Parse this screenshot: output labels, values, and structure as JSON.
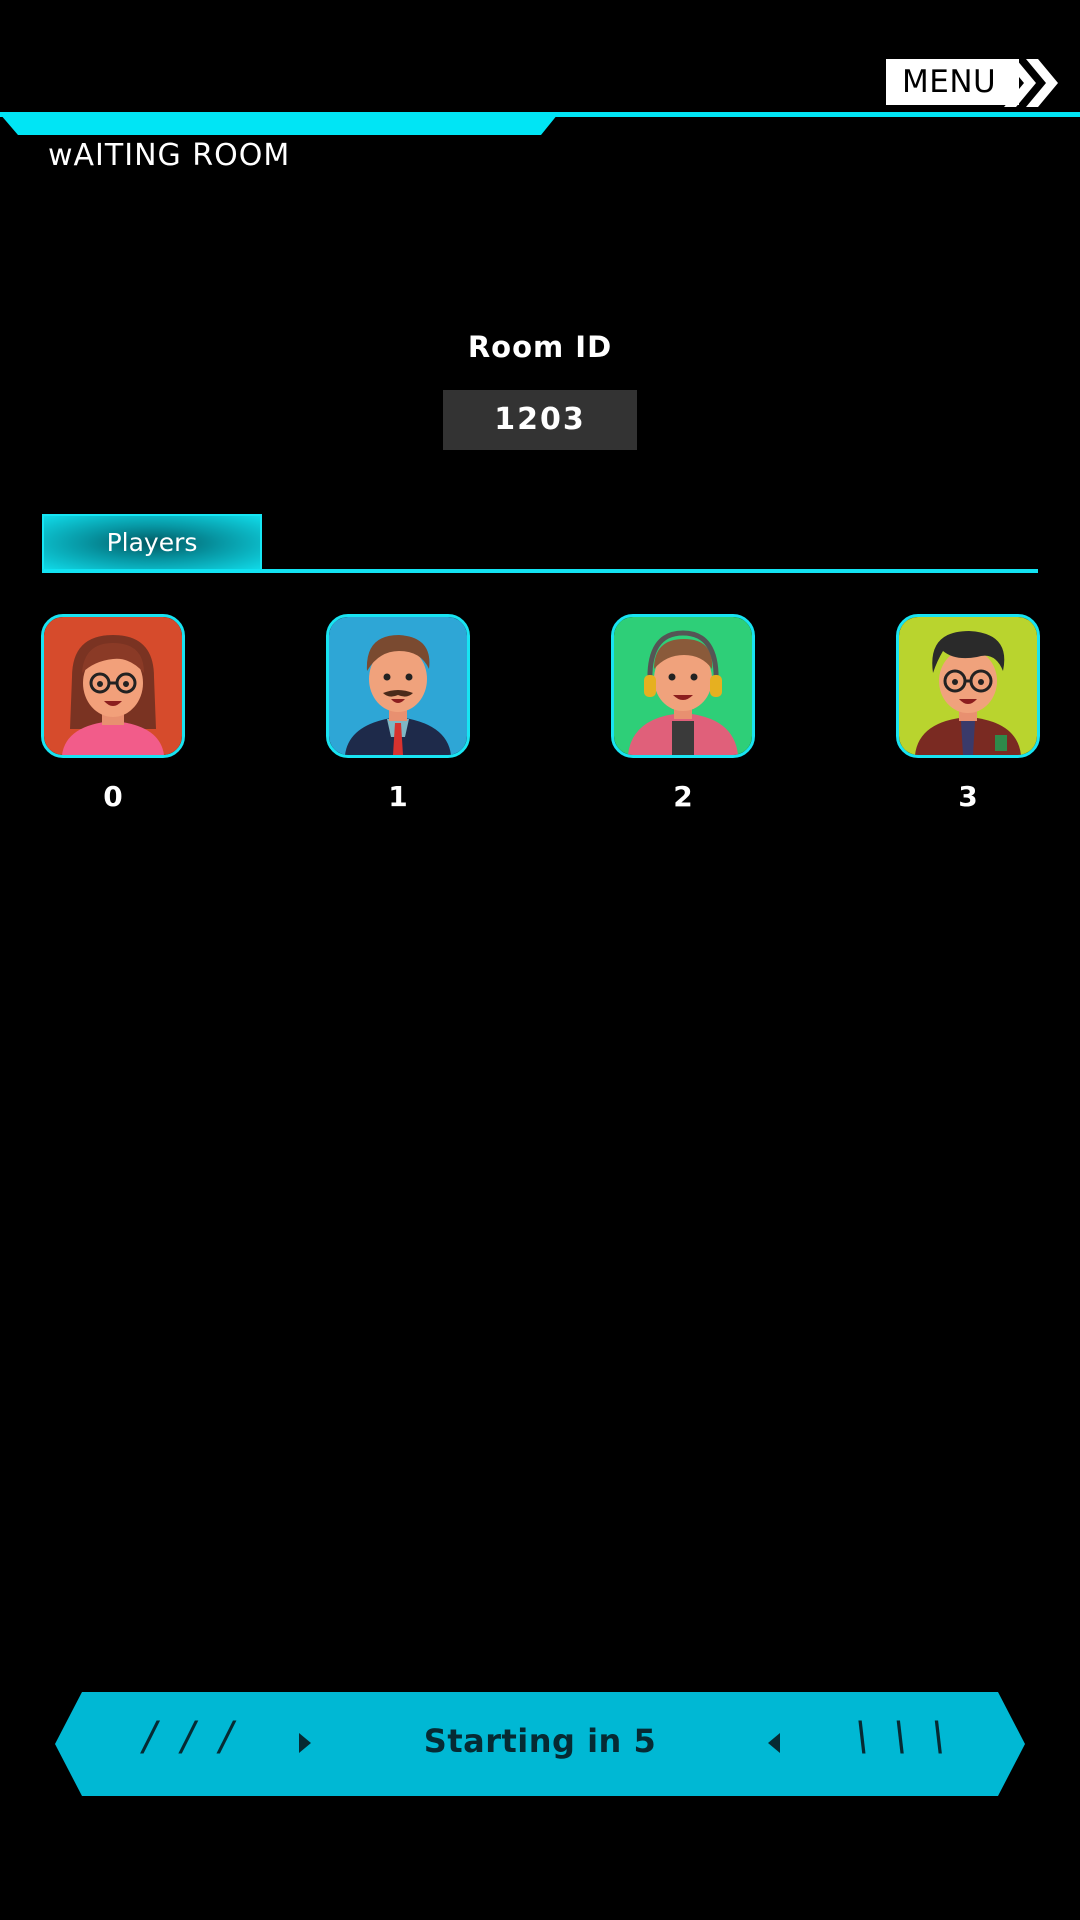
{
  "header": {
    "menu_label": "MENU",
    "title": "wAITING ROOM"
  },
  "room": {
    "label": "Room ID",
    "id": "1203"
  },
  "players_tab": {
    "label": "Players"
  },
  "players": [
    {
      "number": "0",
      "avatar": "woman-glasses-avatar",
      "bg_color": "#d64b2c"
    },
    {
      "number": "1",
      "avatar": "man-suit-mustache-avatar",
      "bg_color": "#2ea6d6"
    },
    {
      "number": "2",
      "avatar": "man-headphones-avatar",
      "bg_color": "#2ecf78"
    },
    {
      "number": "3",
      "avatar": "man-curly-glasses-avatar",
      "bg_color": "#b9d42e"
    }
  ],
  "footer": {
    "left_decor": "/ / /",
    "right_decor": "\\ \\ \\",
    "start_label": "Starting in 5"
  },
  "colors": {
    "accent": "#00e5f5",
    "banner": "#00b8d4",
    "room_box": "#333333"
  }
}
